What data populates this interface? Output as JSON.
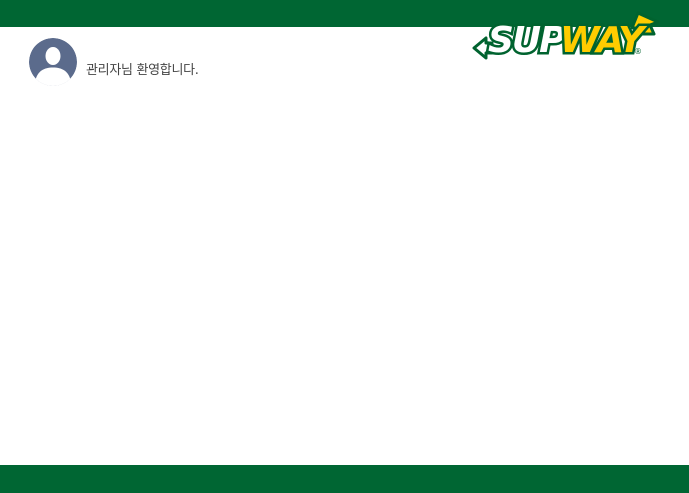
{
  "header": {
    "bar_color": "#006633"
  },
  "user": {
    "avatar_icon": "default-user-avatar",
    "welcome_text": "관리자님 환영합니다."
  },
  "logo": {
    "text_left": "SUP",
    "text_right": "WAY",
    "registered_mark": "®",
    "color_left": "#ffffff",
    "color_right": "#ffcc00",
    "outline_color": "#00632f"
  },
  "footer": {
    "bar_color": "#006633"
  }
}
